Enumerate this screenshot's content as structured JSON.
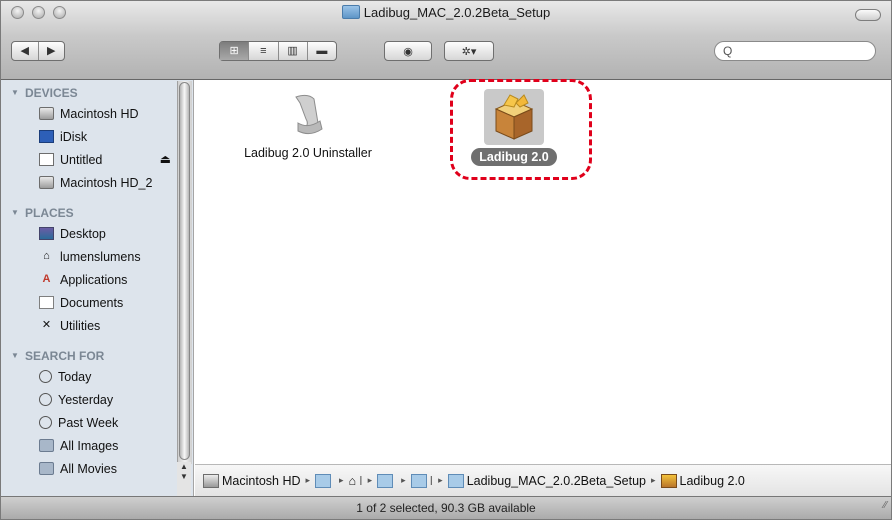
{
  "window": {
    "title": "Ladibug_MAC_2.0.2Beta_Setup"
  },
  "toolbar": {
    "back": "◀",
    "forward": "▶",
    "views": [
      "⊞",
      "≡",
      "▥",
      "▬"
    ],
    "quicklook": "◉",
    "action": "✲▾",
    "search_placeholder": "Q"
  },
  "sidebar": {
    "devices_header": "DEVICES",
    "devices": [
      "Macintosh HD",
      "iDisk",
      "Untitled",
      "Macintosh HD_2"
    ],
    "eject": "⏏",
    "places_header": "PLACES",
    "places": [
      "Desktop",
      "lumenslumens",
      "Applications",
      "Documents",
      "Utilities"
    ],
    "search_header": "SEARCH FOR",
    "searches": [
      "Today",
      "Yesterday",
      "Past Week",
      "All Images",
      "All Movies"
    ]
  },
  "files": [
    {
      "name": "Ladibug 2.0 Uninstaller",
      "icon": "uninstaller-script-icon",
      "selected": false
    },
    {
      "name": "Ladibug 2.0",
      "icon": "package-box-icon",
      "selected": true
    }
  ],
  "path": {
    "root": "Macintosh HD",
    "target_folder": "Ladibug_MAC_2.0.2Beta_Setup",
    "target_item": "Ladibug 2.0",
    "bar_sep": "I"
  },
  "status": {
    "text": "1 of 2 selected, 90.3 GB available"
  },
  "colors": {
    "highlight": "#e0001b",
    "sidebar_bg": "#dde4ec"
  }
}
